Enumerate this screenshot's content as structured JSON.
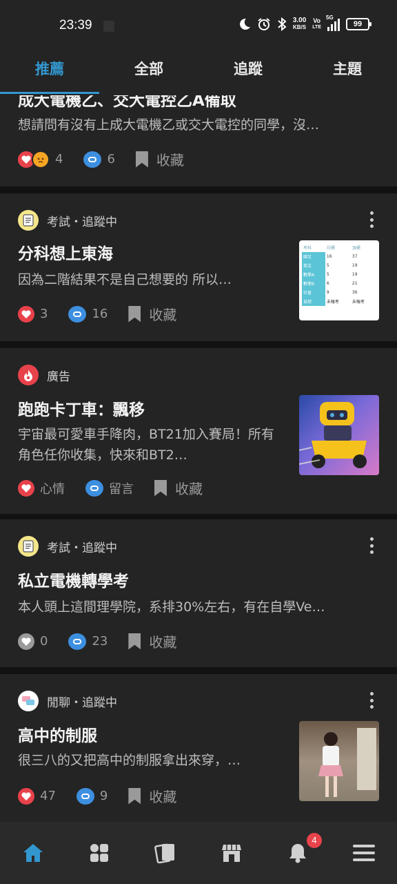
{
  "status_bar": {
    "time": "23:39",
    "net_speed_value": "3.00",
    "net_speed_unit": "KB/S",
    "volte_top": "Vo",
    "volte_bottom": "LTE",
    "signal_label": "5G",
    "battery": "99",
    "icons": [
      "moon-icon",
      "alarm-icon",
      "bluetooth-icon",
      "signal-icon"
    ]
  },
  "tabs": [
    {
      "label": "推薦",
      "active": true
    },
    {
      "label": "全部",
      "active": false
    },
    {
      "label": "追蹤",
      "active": false
    },
    {
      "label": "主題",
      "active": false
    }
  ],
  "posts": [
    {
      "title": "成大電機乙、交大電控乙A備取",
      "excerpt": "想請問有沒有上成大電機乙或交大電控的同學，沒…",
      "reactions": "4",
      "comments": "6",
      "save_label": "收藏"
    },
    {
      "board": "考試・追蹤中",
      "title": "分科想上東海",
      "excerpt": "因為二階結果不是自己想要的 所以…",
      "reactions": "3",
      "comments": "16",
      "save_label": "收藏",
      "thumb_table": {
        "headers": [
          "考科",
          "均標",
          "頂標"
        ],
        "rows": [
          [
            "國文",
            "16",
            "37"
          ],
          [
            "英文",
            "5",
            "19"
          ],
          [
            "數學A",
            "5",
            "19"
          ],
          [
            "數學B",
            "6",
            "21"
          ],
          [
            "社會",
            "9",
            "36"
          ],
          [
            "自然",
            "未報考",
            "未報考"
          ]
        ]
      }
    },
    {
      "board": "廣告",
      "title": "跑跑卡丁車：飄移",
      "excerpt": "宇宙最可愛車手降肉，BT21加入賽局！所有角色任你收集，快來和BT2…",
      "reactions": "心情",
      "comments": "留言",
      "save_label": "收藏"
    },
    {
      "board": "考試・追蹤中",
      "title": "私立電機轉學考",
      "excerpt": "本人頭上這間理學院，系排30%左右，有在自學Ve…",
      "reactions": "0",
      "comments": "23",
      "save_label": "收藏"
    },
    {
      "board": "閒聊・追蹤中",
      "title": "高中的制服",
      "excerpt": "很三八的又把高中的制服拿出來穿，…",
      "reactions": "47",
      "comments": "9",
      "save_label": "收藏"
    }
  ],
  "bottom_nav": {
    "items": [
      "home-icon",
      "grid-icon",
      "cards-icon",
      "shop-icon",
      "bell-icon",
      "menu-icon"
    ],
    "notification_count": "4"
  },
  "colors": {
    "accent": "#3397cf",
    "background": "#121212",
    "card": "#242424",
    "heart": "#e8424b",
    "comment": "#3d8fe0"
  }
}
